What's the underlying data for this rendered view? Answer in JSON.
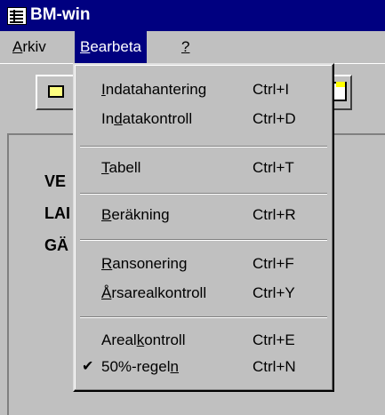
{
  "window": {
    "title": "BM-win"
  },
  "menubar": {
    "items": [
      {
        "pre": "",
        "u": "A",
        "post": "rkiv"
      },
      {
        "pre": "",
        "u": "B",
        "post": "earbeta"
      },
      {
        "pre": "",
        "u": "?",
        "post": ""
      }
    ]
  },
  "content": {
    "labels": [
      "VE",
      "LAI",
      "GÄ"
    ]
  },
  "dropdown": {
    "items": [
      {
        "pre": "",
        "u": "I",
        "post": "ndatahantering",
        "shortcut": "Ctrl+I",
        "checked": false
      },
      {
        "pre": "In",
        "u": "d",
        "post": "atakontroll",
        "shortcut": "Ctrl+D",
        "checked": false
      },
      {
        "pre": "",
        "u": "T",
        "post": "abell",
        "shortcut": "Ctrl+T",
        "checked": false
      },
      {
        "pre": "",
        "u": "B",
        "post": "eräkning",
        "shortcut": "Ctrl+R",
        "checked": false
      },
      {
        "pre": "",
        "u": "R",
        "post": "ansonering",
        "shortcut": "Ctrl+F",
        "checked": false
      },
      {
        "pre": "",
        "u": "Å",
        "post": "rsarealkontroll",
        "shortcut": "Ctrl+Y",
        "checked": false
      },
      {
        "pre": "Areal",
        "u": "k",
        "post": "ontroll",
        "shortcut": "Ctrl+E",
        "checked": false
      },
      {
        "pre": "50%-regel",
        "u": "n",
        "post": "",
        "shortcut": "Ctrl+N",
        "checked": true
      }
    ],
    "check_glyph": "✔"
  }
}
